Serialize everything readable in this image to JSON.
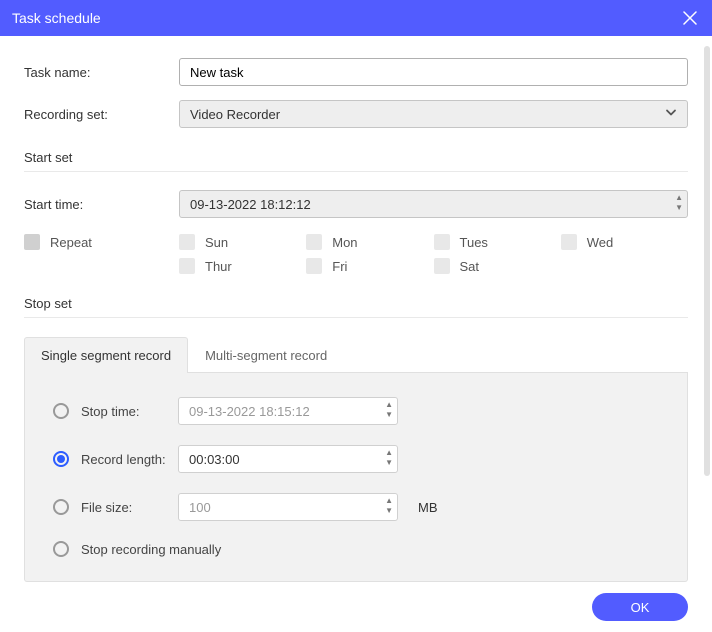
{
  "titlebar": {
    "title": "Task schedule"
  },
  "task_name": {
    "label": "Task name:",
    "value": "New task"
  },
  "recording_set": {
    "label": "Recording set:",
    "selected": "Video Recorder"
  },
  "start_set": {
    "heading": "Start set"
  },
  "start_time": {
    "label": "Start time:",
    "value": "09-13-2022 18:12:12"
  },
  "repeat": {
    "label": "Repeat",
    "days": [
      "Sun",
      "Mon",
      "Tues",
      "Wed",
      "Thur",
      "Fri",
      "Sat"
    ]
  },
  "stop_set": {
    "heading": "Stop set"
  },
  "tabs": {
    "single": "Single segment record",
    "multi": "Multi-segment record"
  },
  "stop_options": {
    "stop_time": {
      "label": "Stop time:",
      "value": "09-13-2022 18:15:12"
    },
    "record_length": {
      "label": "Record length:",
      "value": "00:03:00"
    },
    "file_size": {
      "label": "File size:",
      "value": "100",
      "unit": "MB"
    },
    "manual": {
      "label": "Stop recording manually"
    }
  },
  "footer": {
    "ok": "OK"
  }
}
